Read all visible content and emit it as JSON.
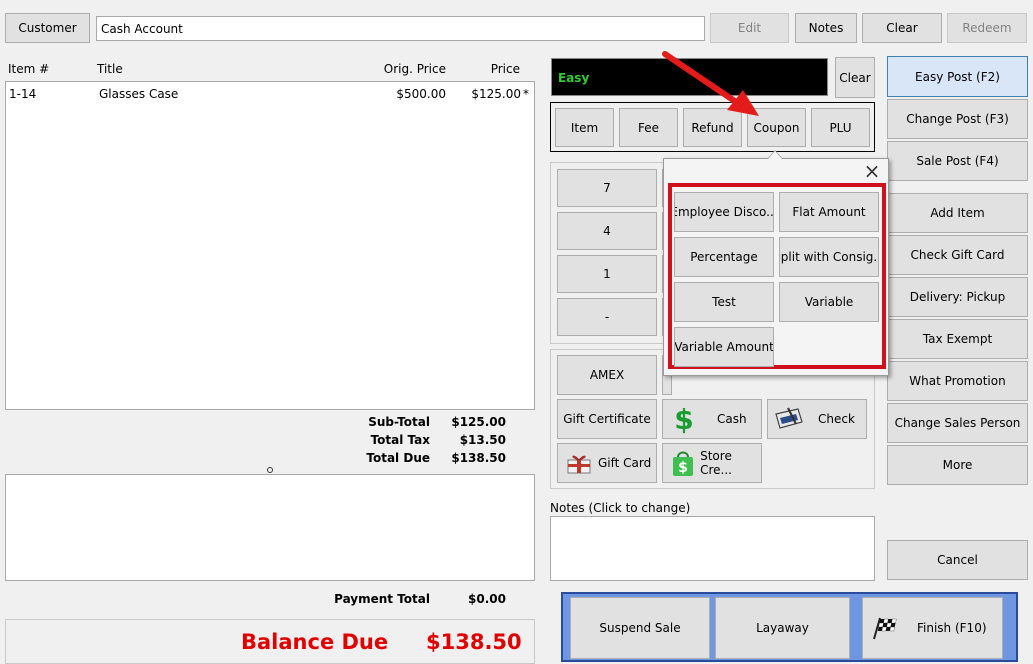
{
  "header": {
    "customer_button": "Customer",
    "customer_value": "Cash Account",
    "edit_button": "Edit",
    "notes_button": "Notes",
    "clear_button": "Clear",
    "redeem_button": "Redeem"
  },
  "grid": {
    "columns": [
      "Item #",
      "Title",
      "Orig. Price",
      "Price"
    ],
    "rows": [
      {
        "item": "1-14",
        "title": "Glasses Case",
        "orig_price": "$500.00",
        "price": "$125.00",
        "marker": "*"
      }
    ]
  },
  "totals": {
    "subtotal_label": "Sub-Total",
    "subtotal_value": "$125.00",
    "tax_label": "Total Tax",
    "tax_value": "$13.50",
    "due_label": "Total Due",
    "due_value": "$138.50",
    "payment_label": "Payment Total",
    "payment_value": "$0.00",
    "balance_label": "Balance Due",
    "balance_value": "$138.50"
  },
  "entry": {
    "display_text": "Easy",
    "clear_button": "Clear",
    "tabs": [
      "Item",
      "Fee",
      "Refund",
      "Coupon",
      "PLU"
    ]
  },
  "keypad": {
    "keys": [
      "7",
      "4",
      "1",
      "-"
    ]
  },
  "coupon_popup": {
    "close": "×",
    "options": [
      "Employee Disco...",
      "Flat Amount",
      "Percentage",
      "Split with Consig...",
      "Test",
      "Variable",
      "Variable Amount"
    ]
  },
  "payments": {
    "amex": "AMEX",
    "gift_certificate": "Gift Certificate",
    "cash": "Cash",
    "check": "Check",
    "gift_card": "Gift Card",
    "store_credit": "Store Cre..."
  },
  "notes": {
    "label": "Notes (Click to change)"
  },
  "right_menu": {
    "easy_post": "Easy Post (F2)",
    "change_post": "Change Post (F3)",
    "sale_post": "Sale Post (F4)",
    "add_item": "Add Item",
    "check_gift_card": "Check Gift Card",
    "delivery": "Delivery: Pickup",
    "tax_exempt": "Tax Exempt",
    "what_promotion": "What Promotion",
    "change_sales_person": "Change Sales Person",
    "more": "More",
    "cancel": "Cancel"
  },
  "footer": {
    "suspend": "Suspend Sale",
    "layaway": "Layaway",
    "finish": "Finish (F10)"
  },
  "colors": {
    "balance_red": "#e00000",
    "highlight_red": "#d0101c",
    "display_green": "#2ecc2e",
    "footer_blue": "#6f96e0"
  }
}
